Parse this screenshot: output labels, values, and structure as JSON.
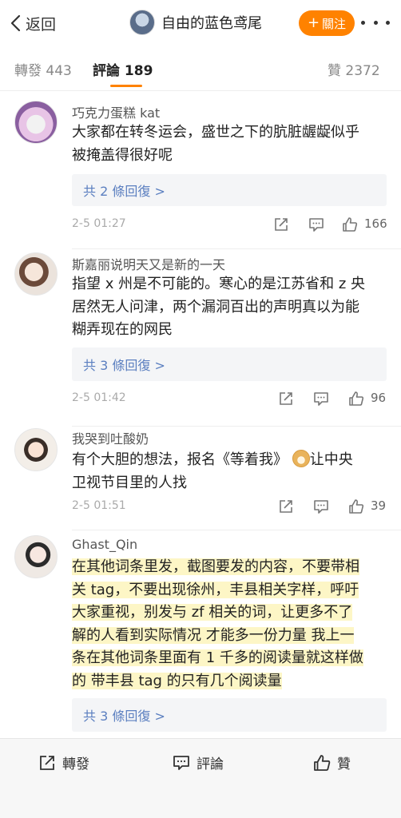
{
  "nav": {
    "back_label": "返回",
    "title": "自由的蓝色鸢尾",
    "follow_label": "關注",
    "follow_plus": "+",
    "accent_color": "#ff8200"
  },
  "tabs": [
    {
      "label": "轉發",
      "count": "443",
      "active": false
    },
    {
      "label": "評論",
      "count": "189",
      "active": true
    },
    {
      "label": "贊",
      "count": "2372",
      "active": false
    }
  ],
  "comments": [
    {
      "username": "巧克力蛋糕 kat",
      "lines": [
        "大家都在转冬运会，盛世之下的肮脏龌龊似乎",
        "被掩盖得很好呢"
      ],
      "replies": "共 2 條回復 >",
      "time": "2-5 01:27",
      "likes": "166"
    },
    {
      "username": "斯嘉丽说明天又是新的一天",
      "lines": [
        "指望 x 州是不可能的。寒心的是江苏省和 z 央",
        "居然无人问津，两个漏洞百出的声明真以为能",
        "糊弄现在的网民"
      ],
      "replies": "共 3 條回復 >",
      "time": "2-5 01:42",
      "likes": "96"
    },
    {
      "username": "我哭到吐酸奶",
      "lines": [
        "有个大胆的想法，报名《等着我》",
        "卫视节目里的人找"
      ],
      "inline_emoji": "doge-emoji",
      "line1_tail": "让中央",
      "time": "2-5 01:51",
      "likes": "39"
    },
    {
      "username": "Ghast_Qin",
      "lines": [
        "在其他词条里发，截图要发的内容，不要带相",
        "关 tag，不要出现徐州，丰县相关字样，呼吁",
        "大家重视，别发与 zf 相关的词，让更多不了",
        "解的人看到实际情况 才能多一份力量 我上一",
        "条在其他词条里面有 1 千多的阅读量就这样做",
        "的 带丰县 tag 的只有几个阅读量"
      ],
      "replies": "共 3 條回復 >",
      "highlight_color": "#fdf6c6"
    }
  ],
  "bottom_bar": {
    "repost": "轉發",
    "comment": "評論",
    "like": "贊"
  },
  "icons": [
    "chevron-left-icon",
    "more-dots-icon",
    "share-icon",
    "comment-icon",
    "like-icon",
    "doge-emoji"
  ]
}
